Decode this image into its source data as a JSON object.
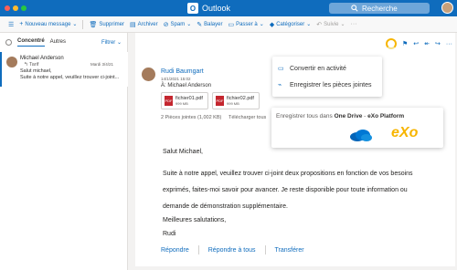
{
  "window": {
    "title": "Outlook",
    "app_icon": "O",
    "search_label": "Recherche"
  },
  "toolbar": {
    "new_message": "Nouveau message",
    "delete": "Supprimer",
    "archive": "Archiver",
    "spam": "Spam",
    "sweep": "Balayer",
    "move_to": "Passer à",
    "categorize": "Catégoriser",
    "read_only": "Suivie"
  },
  "message_list": {
    "tab_focused": "Concentré",
    "tab_other": "Autres",
    "filter": "Filtrer",
    "items": [
      {
        "sender": "Michael Anderson",
        "subject": "Tarif",
        "date": "Mardi 3/4/21",
        "preview_1": "Salut michael,",
        "preview_2": "Suite à notre appel, veuillez trouver ci-joint..."
      }
    ]
  },
  "reading": {
    "sender": "Rudi Baumgart",
    "date": "14/1/2021 15:02",
    "to": "À: Michael Anderson",
    "attachments": [
      {
        "name": "fichier01.pdf",
        "size": "999 MB"
      },
      {
        "name": "fichier02.pdf",
        "size": "999 MB"
      }
    ],
    "attachments_info": "2 Pièces jointes (1,002 KB)",
    "download_label": "Télécharger tous",
    "greeting": "Salut Michael,",
    "body_1": "Suite à notre appel, veuillez trouver ci-joint deux propositions en fonction de vos besoins",
    "body_2": "exprimés, faites-moi savoir pour avancer. Je reste disponible pour toute information ou",
    "body_3": "demande de démonstration supplémentaire.",
    "closing": "Meilleures salutations,",
    "signature": "Rudi",
    "reply": "Répondre",
    "reply_all": "Répondre à tous",
    "forward": "Transférer"
  },
  "menu": {
    "convert": "Convertir en activité",
    "save_attachments": "Enregistrer les pièces jointes"
  },
  "save_popup": {
    "prefix": "Enregistrer tous dans",
    "onedrive": "One Drive",
    "separator": "-",
    "exo": "eXo Platform",
    "exo_logo": "eXo"
  },
  "colors": {
    "accent": "#0f6cbd",
    "exo": "#f7b500",
    "onedrive": "#0078d4"
  }
}
